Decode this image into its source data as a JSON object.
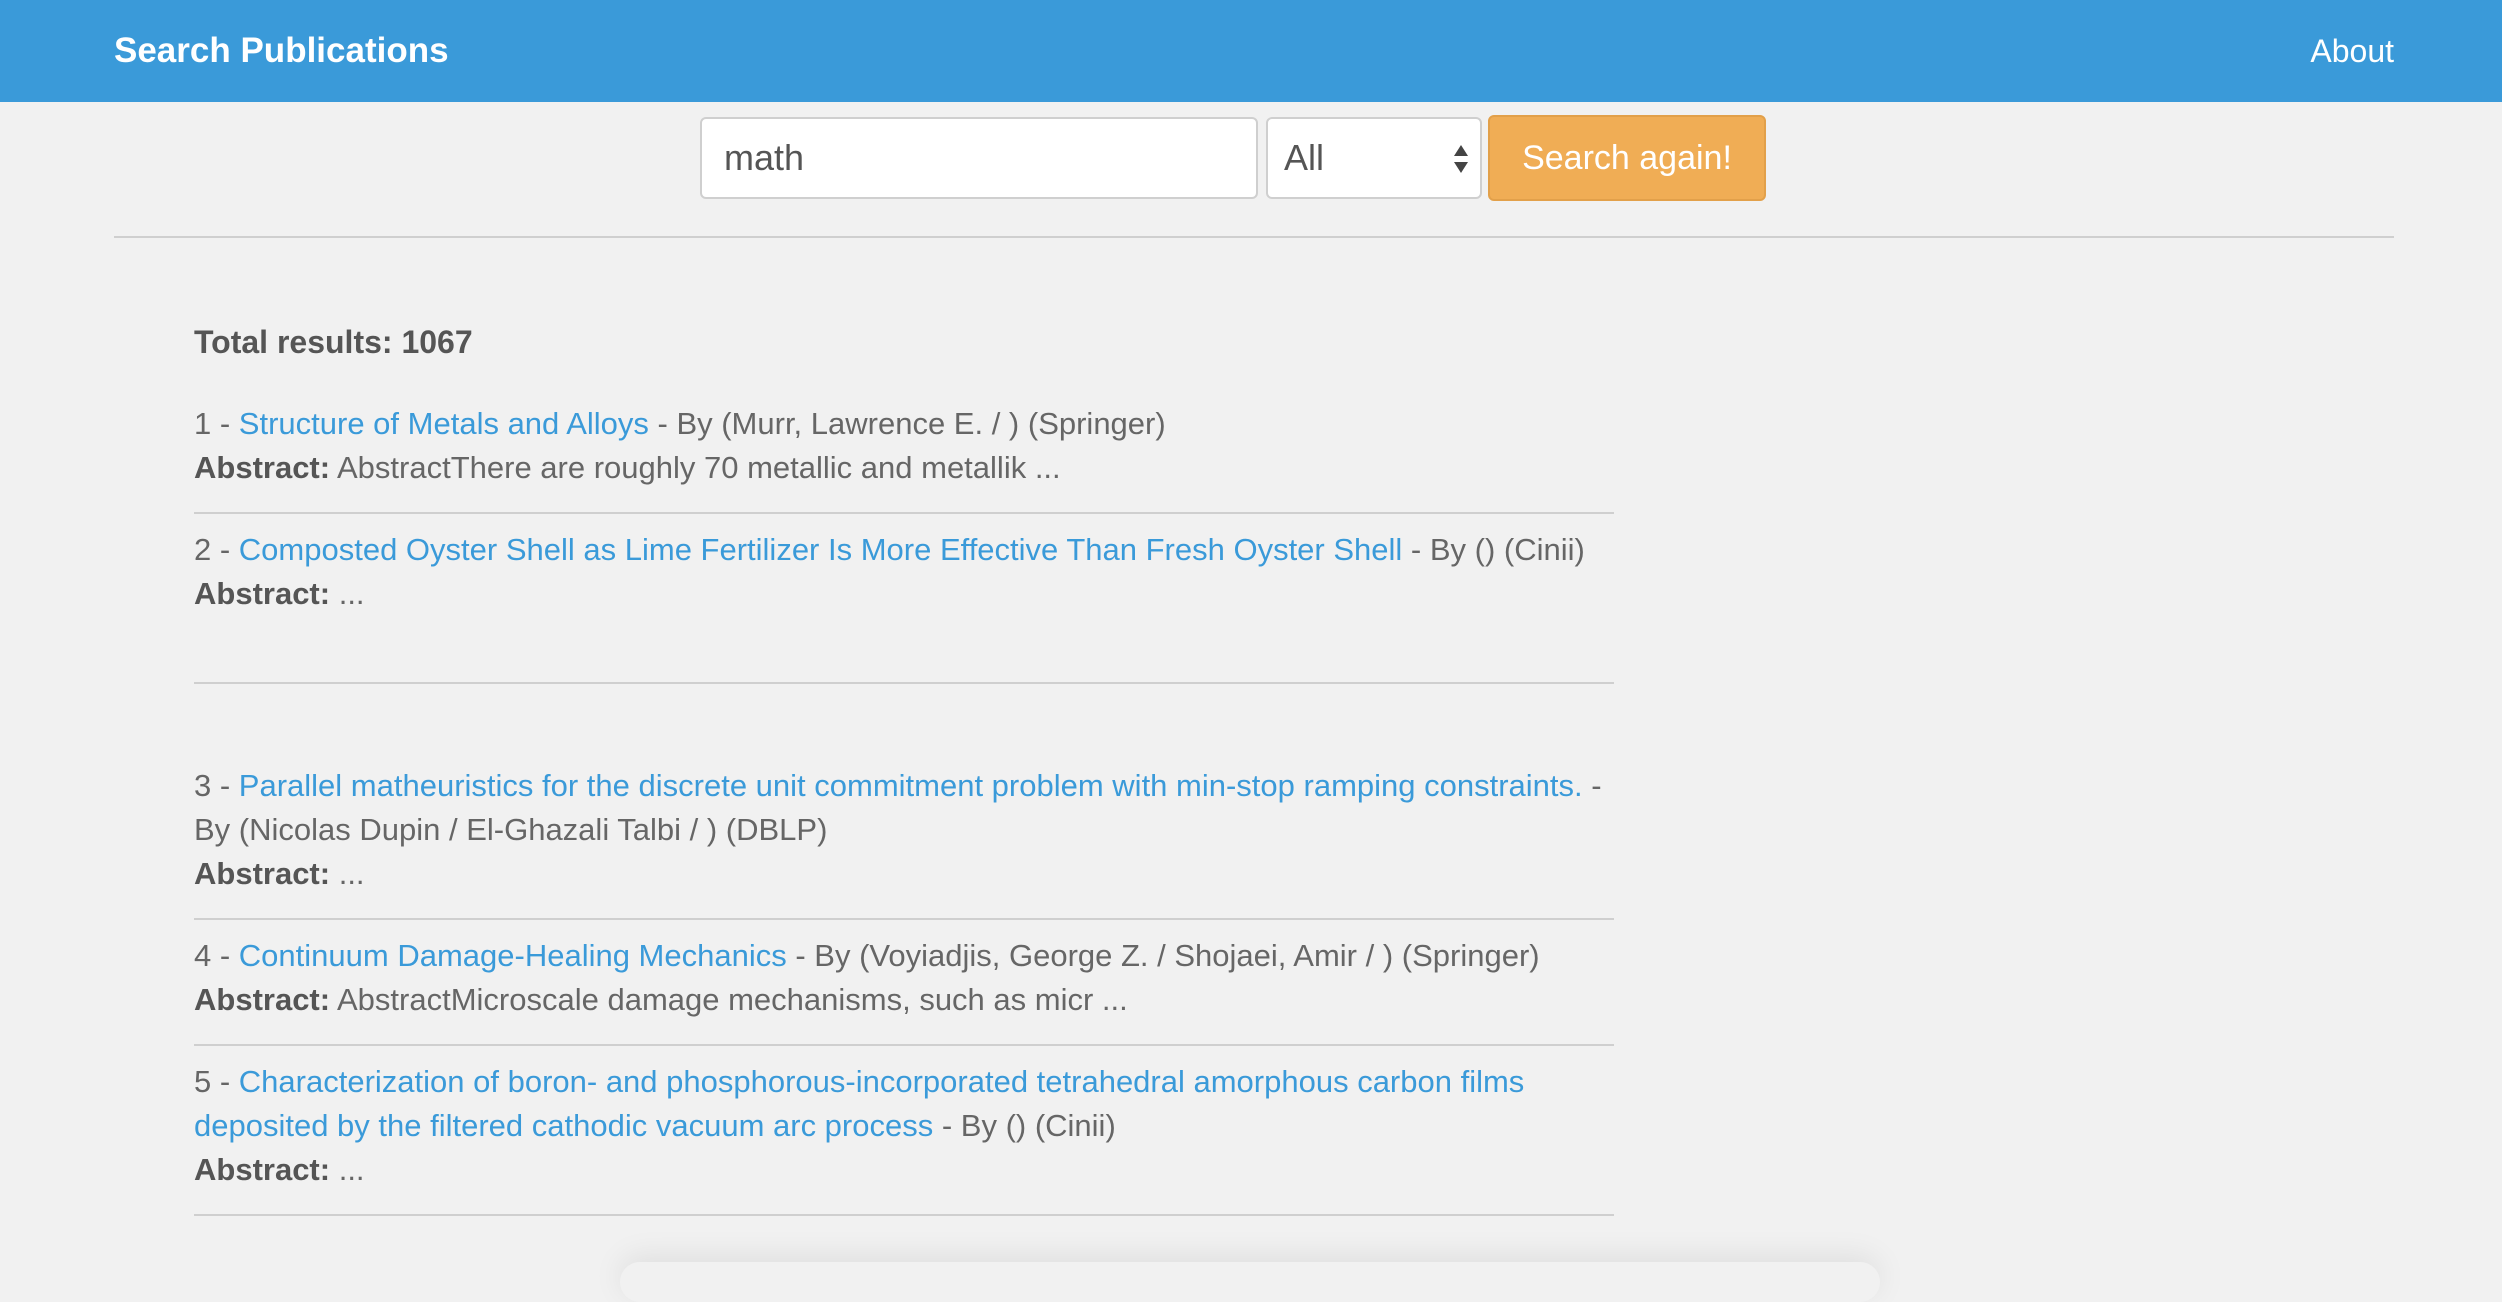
{
  "navbar": {
    "brand": "Search Publications",
    "about": "About"
  },
  "search": {
    "query": "math",
    "filter": "All",
    "button_label": "Search again!"
  },
  "results": {
    "total_label": "Total results: 1067",
    "abstract_label": "Abstract:",
    "items": [
      {
        "prefix": "1 - ",
        "title": "Structure of Metals and Alloys",
        "byline": " - By (Murr, Lawrence E. / ) (Springer)",
        "abstract": " AbstractThere are roughly 70 metallic and metallik ..."
      },
      {
        "prefix": "2 - ",
        "title": "Composted Oyster Shell as Lime Fertilizer Is More Effective Than Fresh Oyster Shell",
        "byline": " - By () (Cinii)",
        "abstract": " ..."
      },
      {
        "prefix": "3 - ",
        "title": "Parallel matheuristics for the discrete unit commitment problem with min-stop ramping constraints.",
        "byline": " - By (Nicolas Dupin / El-Ghazali Talbi / ) (DBLP)",
        "abstract": " ..."
      },
      {
        "prefix": "4 - ",
        "title": "Continuum Damage-Healing Mechanics",
        "byline": " - By (Voyiadjis, George Z. / Shojaei, Amir / ) (Springer)",
        "abstract": " AbstractMicroscale damage mechanisms, such as micr ..."
      },
      {
        "prefix": "5 - ",
        "title": "Characterization of boron- and phosphorous-incorporated tetrahedral amorphous carbon films deposited by the filtered cathodic vacuum arc process",
        "byline": " - By () (Cinii)",
        "abstract": " ..."
      }
    ]
  },
  "colors": {
    "navbar_bg": "#3a9ad9",
    "button_bg": "#f0ad55",
    "link": "#3a9ad9"
  }
}
